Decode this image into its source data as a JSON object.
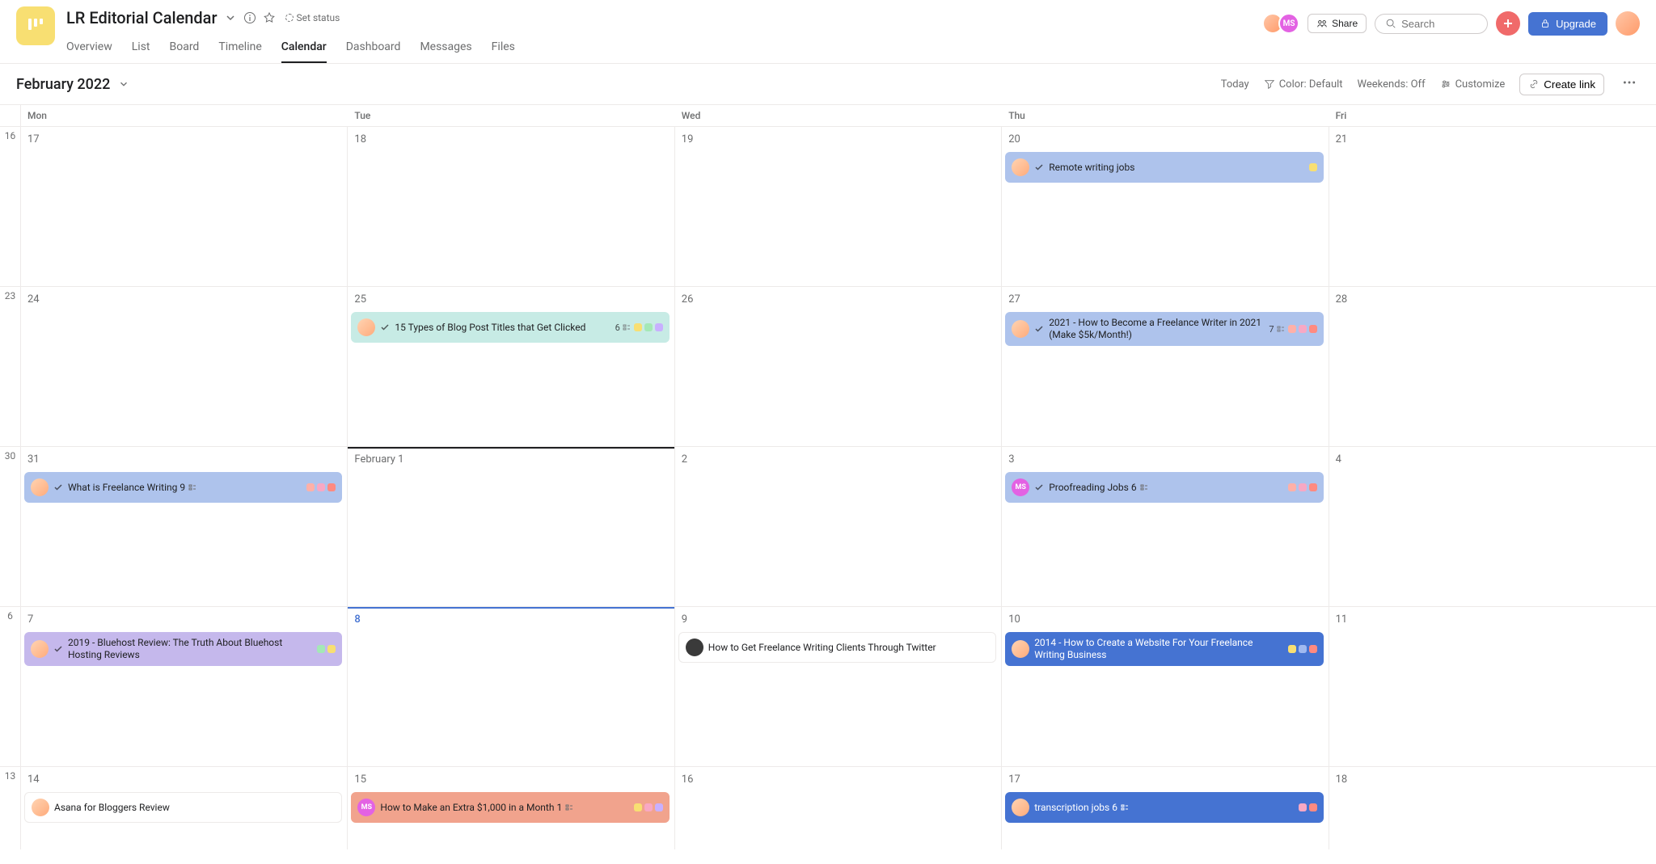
{
  "project": {
    "title": "LR Editorial Calendar",
    "set_status": "Set status"
  },
  "nav_tabs": {
    "overview": "Overview",
    "list": "List",
    "board": "Board",
    "timeline": "Timeline",
    "calendar": "Calendar",
    "dashboard": "Dashboard",
    "messages": "Messages",
    "files": "Files"
  },
  "header_actions": {
    "share": "Share",
    "search_placeholder": "Search",
    "upgrade": "Upgrade"
  },
  "toolbar": {
    "month": "February 2022",
    "today": "Today",
    "color": "Color: Default",
    "weekends": "Weekends: Off",
    "customize": "Customize",
    "create_link": "Create link"
  },
  "day_headers": {
    "mon": "Mon",
    "tue": "Tue",
    "wed": "Wed",
    "thu": "Thu",
    "fri": "Fri"
  },
  "weeks": {
    "w1": {
      "num": "16",
      "mon": "17",
      "tue": "18",
      "wed": "19",
      "thu": "20",
      "fri": "21"
    },
    "w2": {
      "num": "23",
      "mon": "24",
      "tue": "25",
      "wed": "26",
      "thu": "27",
      "fri": "28"
    },
    "w3": {
      "num": "30",
      "mon": "31",
      "tue": "February 1",
      "wed": "2",
      "thu": "3",
      "fri": "4"
    },
    "w4": {
      "num": "6",
      "mon": "7",
      "tue": "8",
      "wed": "9",
      "thu": "10",
      "fri": "11"
    },
    "w5": {
      "num": "13",
      "mon": "14",
      "tue": "15",
      "wed": "16",
      "thu": "17",
      "fri": "18"
    }
  },
  "tasks": {
    "remote_writing": {
      "title": "Remote writing jobs",
      "assignee": "user1",
      "completed": true,
      "tags": [
        "yellow"
      ]
    },
    "blog_titles": {
      "title": "15 Types of Blog Post Titles that Get Clicked",
      "assignee": "user1",
      "completed": true,
      "subtasks": "6",
      "tags": [
        "yellow",
        "green",
        "purple"
      ]
    },
    "freelance_2021": {
      "title": "2021 - How to Become a Freelance Writer in 2021 (Make $5k/Month!)",
      "assignee": "user1",
      "completed": true,
      "subtasks": "7",
      "tags": [
        "salmon",
        "pink",
        "red"
      ]
    },
    "what_is_freelance": {
      "title": "What is Freelance Writing",
      "assignee": "user1",
      "completed": true,
      "subtasks": "9",
      "tags": [
        "salmon",
        "pink",
        "red"
      ]
    },
    "proofreading": {
      "title": "Proofreading Jobs",
      "assignee": "MS",
      "completed": true,
      "subtasks": "6",
      "tags": [
        "salmon",
        "pink",
        "red"
      ]
    },
    "bluehost": {
      "title": "2019 - Bluehost Review: The Truth About Bluehost Hosting Reviews",
      "assignee": "user1",
      "completed": true,
      "tags": [
        "green",
        "yellow"
      ]
    },
    "twitter_clients": {
      "title": "How to Get Freelance Writing Clients Through Twitter",
      "assignee": "dark"
    },
    "website_2014": {
      "title": "2014 - How to Create a Website For Your Freelance Writing Business",
      "assignee": "user1",
      "tags": [
        "yellow",
        "blue",
        "red"
      ]
    },
    "asana_bloggers": {
      "title": "Asana for Bloggers Review",
      "assignee": "user1"
    },
    "extra_1000": {
      "title": "How to Make an Extra $1,000 in a Month",
      "assignee": "MS",
      "subtasks": "1",
      "tags": [
        "yellow",
        "pink",
        "purple"
      ]
    },
    "transcription": {
      "title": "transcription jobs",
      "assignee": "user1",
      "subtasks": "6",
      "tags": [
        "pink",
        "red"
      ]
    }
  },
  "avatar_labels": {
    "ms": "MS"
  }
}
